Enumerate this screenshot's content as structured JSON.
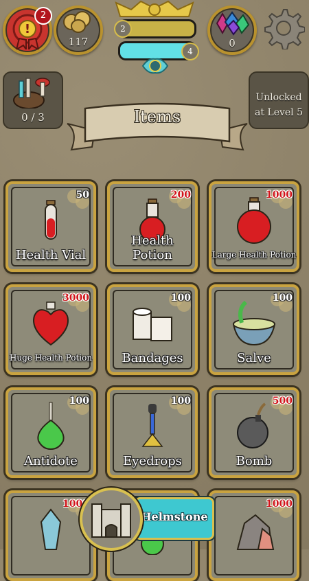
{
  "hud": {
    "notifications": "2",
    "gold": "117",
    "level": "2",
    "xp_level": "4",
    "gems": "0"
  },
  "bag": {
    "count": "0 / 3"
  },
  "locked": {
    "text_line1": "Unlocked",
    "text_line2": "at Level 5"
  },
  "banner": {
    "title": "Items"
  },
  "items": [
    {
      "name": "Health Vial",
      "price": "50",
      "price_color": "#ffffff"
    },
    {
      "name": "Health Potion",
      "price": "200",
      "price_color": "#d0141a"
    },
    {
      "name": "Large Health Potion",
      "price": "1000",
      "price_color": "#d0141a"
    },
    {
      "name": "Huge Health Potion",
      "price": "3000",
      "price_color": "#d0141a"
    },
    {
      "name": "Bandages",
      "price": "100",
      "price_color": "#ffffff"
    },
    {
      "name": "Salve",
      "price": "100",
      "price_color": "#ffffff"
    },
    {
      "name": "Antidote",
      "price": "100",
      "price_color": "#ffffff"
    },
    {
      "name": "Eyedrops",
      "price": "100",
      "price_color": "#ffffff"
    },
    {
      "name": "Bomb",
      "price": "500",
      "price_color": "#d0141a"
    },
    {
      "name": "",
      "price": "1000",
      "price_color": "#d0141a"
    },
    {
      "name": "",
      "price": "",
      "price_color": "#ffffff"
    },
    {
      "name": "",
      "price": "1000",
      "price_color": "#d0141a"
    }
  ],
  "town": {
    "name": "Helmstone"
  }
}
